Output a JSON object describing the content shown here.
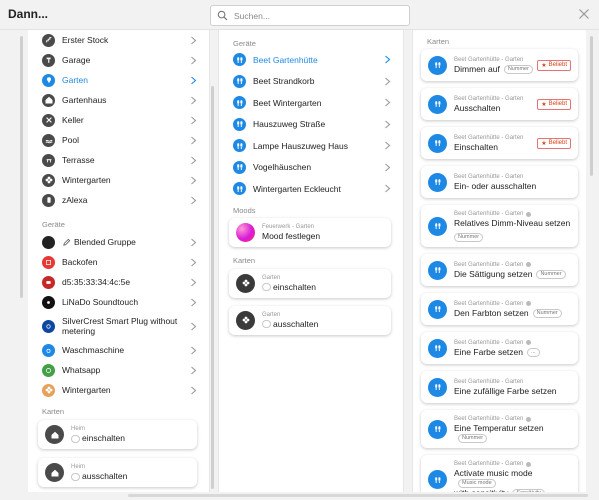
{
  "header": {
    "title": "Dann...",
    "search_placeholder": "Suchen..."
  },
  "colors": {
    "accent": "#1e88e5",
    "dark_icon": "#4a4a4a",
    "beliebt_red": "#d84315"
  },
  "col1": {
    "rooms": [
      {
        "label": "Erster Stock",
        "icon": "stairs-icon"
      },
      {
        "label": "Garage",
        "icon": "hammer-icon"
      },
      {
        "label": "Garten",
        "icon": "pin-icon",
        "active": true
      },
      {
        "label": "Gartenhaus",
        "icon": "house-icon"
      },
      {
        "label": "Keller",
        "icon": "tools-icon"
      },
      {
        "label": "Pool",
        "icon": "pool-icon"
      },
      {
        "label": "Terrasse",
        "icon": "terrace-icon"
      },
      {
        "label": "Wintergarten",
        "icon": "plant-icon"
      },
      {
        "label": "zAlexa",
        "icon": "speaker-icon"
      }
    ],
    "devices_label": "Geräte",
    "devices": [
      {
        "label": "Blended Gruppe",
        "icon": "blended-icon"
      },
      {
        "label": "Backofen",
        "icon": "oven-icon"
      },
      {
        "label": "d5:35:33:34:4c:5e",
        "icon": "device-icon"
      },
      {
        "label": "LiNaDo Soundtouch",
        "icon": "soundtouch-icon"
      },
      {
        "label": "SilverCrest Smart Plug without metering",
        "icon": "plug-icon"
      },
      {
        "label": "Waschmaschine",
        "icon": "washer-icon"
      },
      {
        "label": "Whatsapp",
        "icon": "whatsapp-icon"
      },
      {
        "label": "Wintergarten",
        "icon": "plant-icon"
      }
    ],
    "cards_label": "Karten",
    "cards": [
      {
        "sub": "Heim",
        "main": "einschalten"
      },
      {
        "sub": "Heim",
        "main": "ausschalten"
      }
    ]
  },
  "col2": {
    "devices_label": "Geräte",
    "devices": [
      {
        "label": "Beet Gartenhütte",
        "active": true
      },
      {
        "label": "Beet Strandkorb"
      },
      {
        "label": "Beet Wintergarten"
      },
      {
        "label": "Hauszuweg Straße"
      },
      {
        "label": "Lampe Hauszuweg Haus"
      },
      {
        "label": "Vogelhäuschen"
      },
      {
        "label": "Wintergarten Eckleucht"
      }
    ],
    "moods_label": "Moods",
    "mood": {
      "sub": "Feuerwerk - Garten",
      "main": "Mood festlegen"
    },
    "cards_label": "Karten",
    "cards": [
      {
        "sub": "Garten",
        "main": "einschalten"
      },
      {
        "sub": "Garten",
        "main": "ausschalten"
      }
    ]
  },
  "col3": {
    "cards_label": "Karten",
    "cards": [
      {
        "sub": "Beet Gartenhütte - Garten",
        "main": "Dimmen auf",
        "tag": "Nummer",
        "beliebt": "Beliebt"
      },
      {
        "sub": "Beet Gartenhütte - Garten",
        "main": "Ausschalten",
        "beliebt": "Beliebt"
      },
      {
        "sub": "Beet Gartenhütte - Garten",
        "main": "Einschalten",
        "beliebt": "Beliebt"
      },
      {
        "sub": "Beet Gartenhütte - Garten",
        "main": "Ein- oder ausschalten"
      },
      {
        "sub": "Beet Gartenhütte - Garten",
        "main": "Relatives Dimm-Niveau setzen",
        "tag_below": "Nummer",
        "info": true
      },
      {
        "sub": "Beet Gartenhütte - Garten",
        "main": "Die Sättigung setzen",
        "tag": "Nummer",
        "info": true
      },
      {
        "sub": "Beet Gartenhütte - Garten",
        "main": "Den Farbton setzen",
        "tag": "Nummer",
        "info": true
      },
      {
        "sub": "Beet Gartenhütte - Garten",
        "main": "Eine Farbe setzen",
        "tag": "...",
        "info": true
      },
      {
        "sub": "Beet Gartenhütte - Garten",
        "main": "Eine zufällige Farbe setzen"
      },
      {
        "sub": "Beet Gartenhütte - Garten",
        "main": "Eine Temperatur setzen",
        "tag": "Nummer",
        "info": true
      },
      {
        "sub": "Beet Gartenhütte - Garten",
        "main": "Activate music mode",
        "tag": "Music mode",
        "main2": "with sensitivity",
        "tag2": "Sensitivity",
        "info": true
      }
    ]
  }
}
